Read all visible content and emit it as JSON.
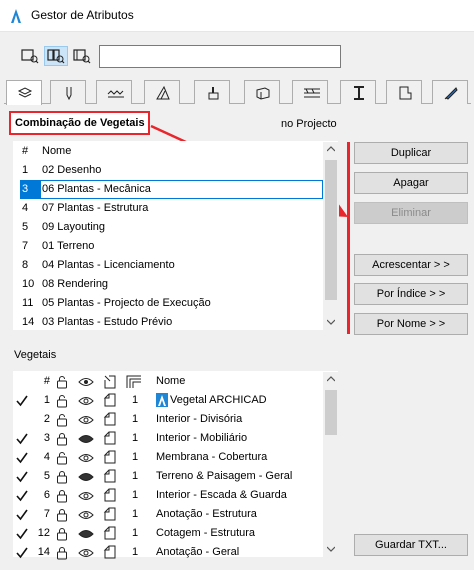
{
  "window": {
    "title": "Gestor de Atributos"
  },
  "search": {
    "value": "",
    "placeholder": ""
  },
  "tabs": [
    "layers",
    "pens",
    "fills",
    "line-types",
    "surfaces",
    "building-materials",
    "profiles",
    "zones",
    "markup",
    "graphic-overrides"
  ],
  "header": {
    "combination_label": "Combinação de Vegetais",
    "status": "no Projecto"
  },
  "combinations": {
    "columns": {
      "num": "#",
      "name": "Nome"
    },
    "rows": [
      {
        "num": "1",
        "name": "02 Desenho"
      },
      {
        "num": "3",
        "name": "06 Plantas - Mecânica",
        "selected": true
      },
      {
        "num": "4",
        "name": "07 Plantas - Estrutura"
      },
      {
        "num": "5",
        "name": "09 Layouting"
      },
      {
        "num": "7",
        "name": "01 Terreno"
      },
      {
        "num": "8",
        "name": "04 Plantas - Licenciamento"
      },
      {
        "num": "10",
        "name": "08 Rendering"
      },
      {
        "num": "11",
        "name": "05 Plantas - Projecto de Execução"
      },
      {
        "num": "14",
        "name": "03 Plantas - Estudo Prévio"
      }
    ]
  },
  "buttons": {
    "duplicar": "Duplicar",
    "apagar": "Apagar",
    "eliminar": "Eliminar",
    "acrescentar": "Acrescentar > >",
    "por_indice": "Por Índice > >",
    "por_nome": "Por Nome > >",
    "guardar": "Guardar TXT..."
  },
  "layers": {
    "section_label": "Vegetais",
    "columns": {
      "num": "#",
      "pen": "1",
      "name": "Nome"
    },
    "rows": [
      {
        "checked": true,
        "num": "1",
        "lock": "unlocked",
        "visibility": "visible",
        "pen": "1",
        "name": "Vegetal ARCHICAD",
        "special": true
      },
      {
        "checked": false,
        "num": "2",
        "lock": "unlocked",
        "visibility": "visible",
        "pen": "1",
        "name": "Interior - Divisória"
      },
      {
        "checked": true,
        "num": "3",
        "lock": "locked",
        "visibility": "hidden",
        "pen": "1",
        "name": "Interior - Mobiliário"
      },
      {
        "checked": true,
        "num": "4",
        "lock": "unlocked",
        "visibility": "visible",
        "pen": "1",
        "name": "Membrana - Cobertura"
      },
      {
        "checked": true,
        "num": "5",
        "lock": "locked",
        "visibility": "hidden",
        "pen": "1",
        "name": "Terreno & Paisagem - Geral"
      },
      {
        "checked": true,
        "num": "6",
        "lock": "locked",
        "visibility": "visible",
        "pen": "1",
        "name": "Interior - Escada & Guarda"
      },
      {
        "checked": true,
        "num": "7",
        "lock": "locked",
        "visibility": "visible",
        "pen": "1",
        "name": "Anotação - Estrutura"
      },
      {
        "checked": true,
        "num": "12",
        "lock": "locked",
        "visibility": "hidden",
        "pen": "1",
        "name": "Cotagem - Estrutura"
      },
      {
        "checked": true,
        "num": "14",
        "lock": "locked",
        "visibility": "visible",
        "pen": "1",
        "name": "Anotação - Geral"
      }
    ]
  },
  "colors": {
    "accent": "#0078d7",
    "annotation_red": "#e8262b"
  }
}
